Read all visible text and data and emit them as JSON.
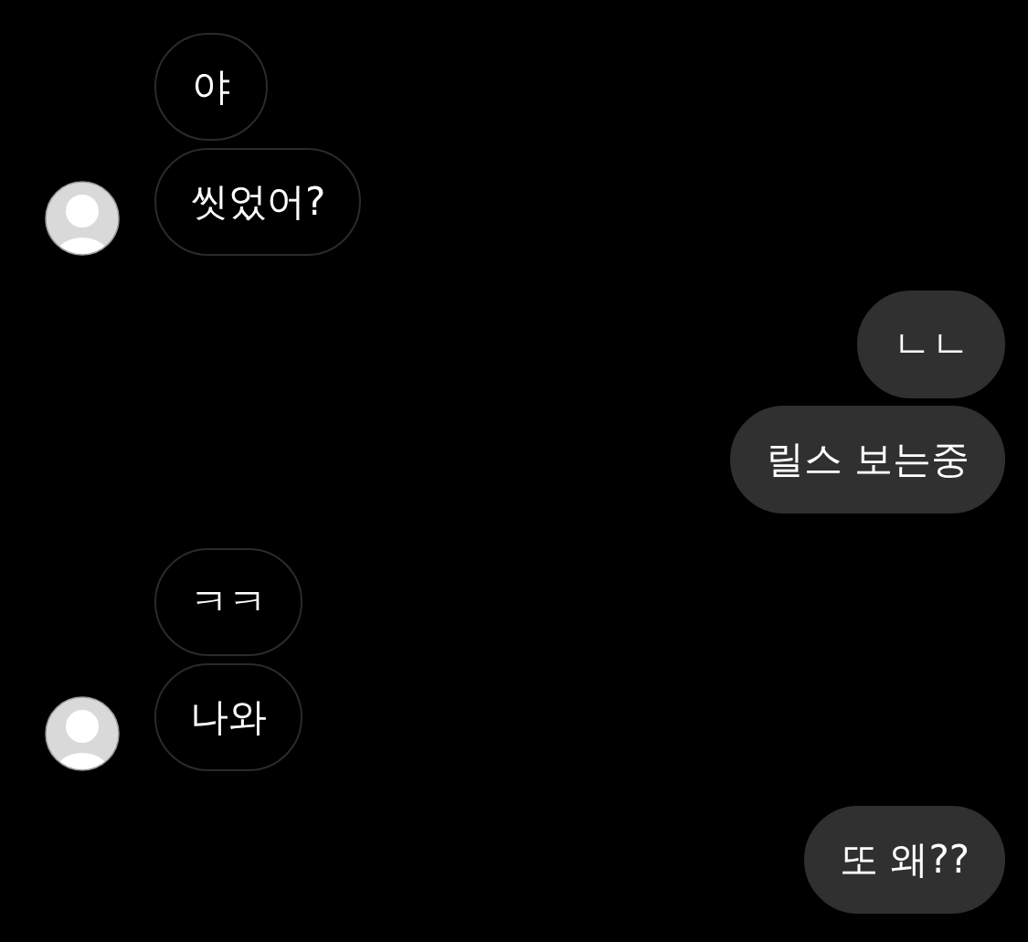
{
  "conversation": [
    {
      "kind": "incoming",
      "messages": [
        "야",
        "씻었어?"
      ]
    },
    {
      "kind": "outgoing",
      "messages": [
        "ㄴㄴ",
        "릴스 보는중"
      ]
    },
    {
      "kind": "incoming",
      "messages": [
        "ㅋㅋ",
        "나와"
      ]
    },
    {
      "kind": "outgoing",
      "messages": [
        "또 왜??"
      ]
    }
  ]
}
